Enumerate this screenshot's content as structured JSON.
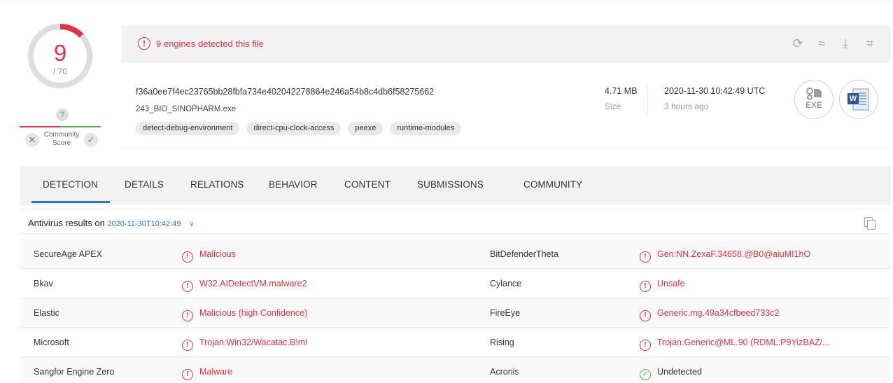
{
  "score": {
    "detected": "9",
    "total": "/ 70",
    "ratio": 0.1286,
    "color": "#e8313f",
    "community_unknown": "?",
    "community_label_1": "Community",
    "community_label_2": "Score",
    "down_vote": "✕",
    "up_vote": "✓"
  },
  "banner": {
    "icon": "!",
    "message": "9 engines detected this file"
  },
  "toolbar": {
    "reanalyze_icon": "⟳",
    "similar_icon": "≈",
    "download_icon": "⤓",
    "graph_icon": "⌗"
  },
  "file": {
    "hash": "f36a0ee7f4ec23765bb28fbfa734e402042278864e246a54b8c4db6f58275662",
    "name": "243_BIO_SINOPHARM.exe",
    "tags": [
      "detect-debug-environment",
      "direct-cpu-clock-access",
      "peexe",
      "runtime-modules"
    ],
    "size_value": "4.71 MB",
    "size_label": "Size",
    "date_value": "2020-11-30 10:42:49 UTC",
    "date_label": "3 hours ago",
    "type_exe_label": "EXE",
    "type_word_label": "W"
  },
  "tabs": [
    "DETECTION",
    "DETAILS",
    "RELATIONS",
    "BEHAVIOR",
    "CONTENT",
    "SUBMISSIONS",
    "COMMUNITY"
  ],
  "results": {
    "label": "Antivirus results on",
    "date": "2020-11-30T10:42:49",
    "chevron": "∨"
  },
  "detections": [
    {
      "left_engine": "SecureAge APEX",
      "left_verdict": "Malicious",
      "right_engine": "BitDefenderTheta",
      "right_verdict": "Gen:NN.ZexaF.34658.@B0@aiuMI1hO",
      "right_clean": false
    },
    {
      "left_engine": "Bkav",
      "left_verdict": "W32.AIDetectVM.malware2",
      "right_engine": "Cylance",
      "right_verdict": "Unsafe",
      "right_clean": false
    },
    {
      "left_engine": "Elastic",
      "left_verdict": "Malicious (high Confidence)",
      "right_engine": "FireEye",
      "right_verdict": "Generic.mg.49a34cfbeed733c2",
      "right_clean": false
    },
    {
      "left_engine": "Microsoft",
      "left_verdict": "Trojan:Win32/Wacatac.B!ml",
      "right_engine": "Rising",
      "right_verdict": "Trojan.Generic@ML.90 (RDML:P9YizBAZ/...",
      "right_clean": false
    },
    {
      "left_engine": "Sangfor Engine Zero",
      "left_verdict": "Malware",
      "right_engine": "Acronis",
      "right_verdict": "Undetected",
      "right_clean": true
    }
  ],
  "colors": {
    "malicious": "#e8313f",
    "clean": "#4caf50",
    "accent": "#2f6fde"
  }
}
